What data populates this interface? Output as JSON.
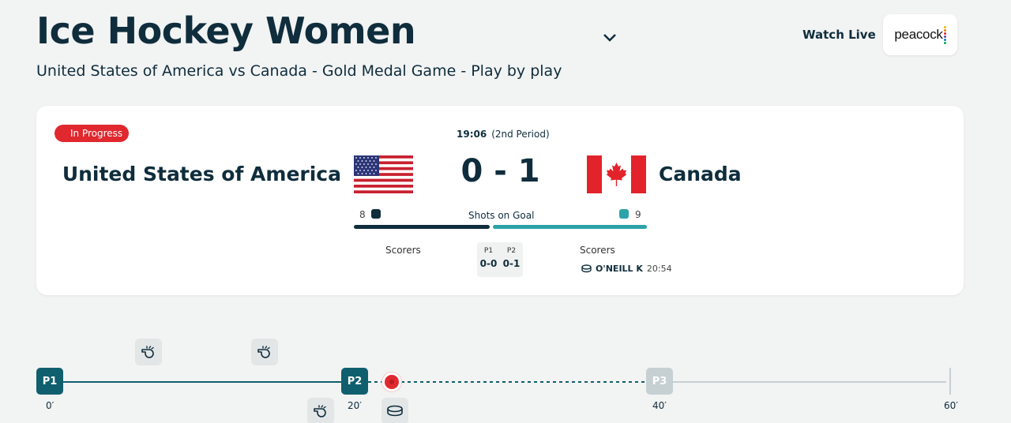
{
  "header": {
    "title": "Ice Hockey Women",
    "subtitle": "United States of America vs Canada - Gold Medal Game - Play by play",
    "watch_live": "Watch Live",
    "peacock_logo": "peacock"
  },
  "match": {
    "status": "In Progress",
    "clock": "19:06",
    "period": "(2nd Period)",
    "home": {
      "name": "United States of America",
      "flag": "usa-flag"
    },
    "away": {
      "name": "Canada",
      "flag": "canada-flag"
    },
    "score": "0 - 1",
    "shots": {
      "label": "Shots on Goal",
      "home": "8",
      "away": "9",
      "home_color": "#0f2d3c",
      "away_color": "#2ba3a8"
    },
    "scorers_label_home": "Scorers",
    "scorers_label_away": "Scorers",
    "periods": [
      {
        "label": "P1",
        "score": "0-0"
      },
      {
        "label": "P2",
        "score": "0-1"
      }
    ],
    "away_goals": [
      {
        "player": "O'NEILL K",
        "time": "20:54"
      }
    ]
  },
  "timeline": {
    "periods": [
      {
        "label": "P1",
        "state": "complete"
      },
      {
        "label": "P2",
        "state": "current"
      },
      {
        "label": "P3",
        "state": "upcoming"
      }
    ],
    "ticks": [
      "0′",
      "20′",
      "40′",
      "60′"
    ],
    "events": [
      {
        "type": "whistle-icon",
        "side": "top"
      },
      {
        "type": "whistle-icon",
        "side": "top"
      },
      {
        "type": "whistle-icon",
        "side": "bottom"
      },
      {
        "type": "puck-icon",
        "side": "bottom"
      }
    ],
    "colors": {
      "active": "#0f5f6e",
      "upcoming": "#c6d0d3",
      "live": "#e0282e"
    }
  }
}
